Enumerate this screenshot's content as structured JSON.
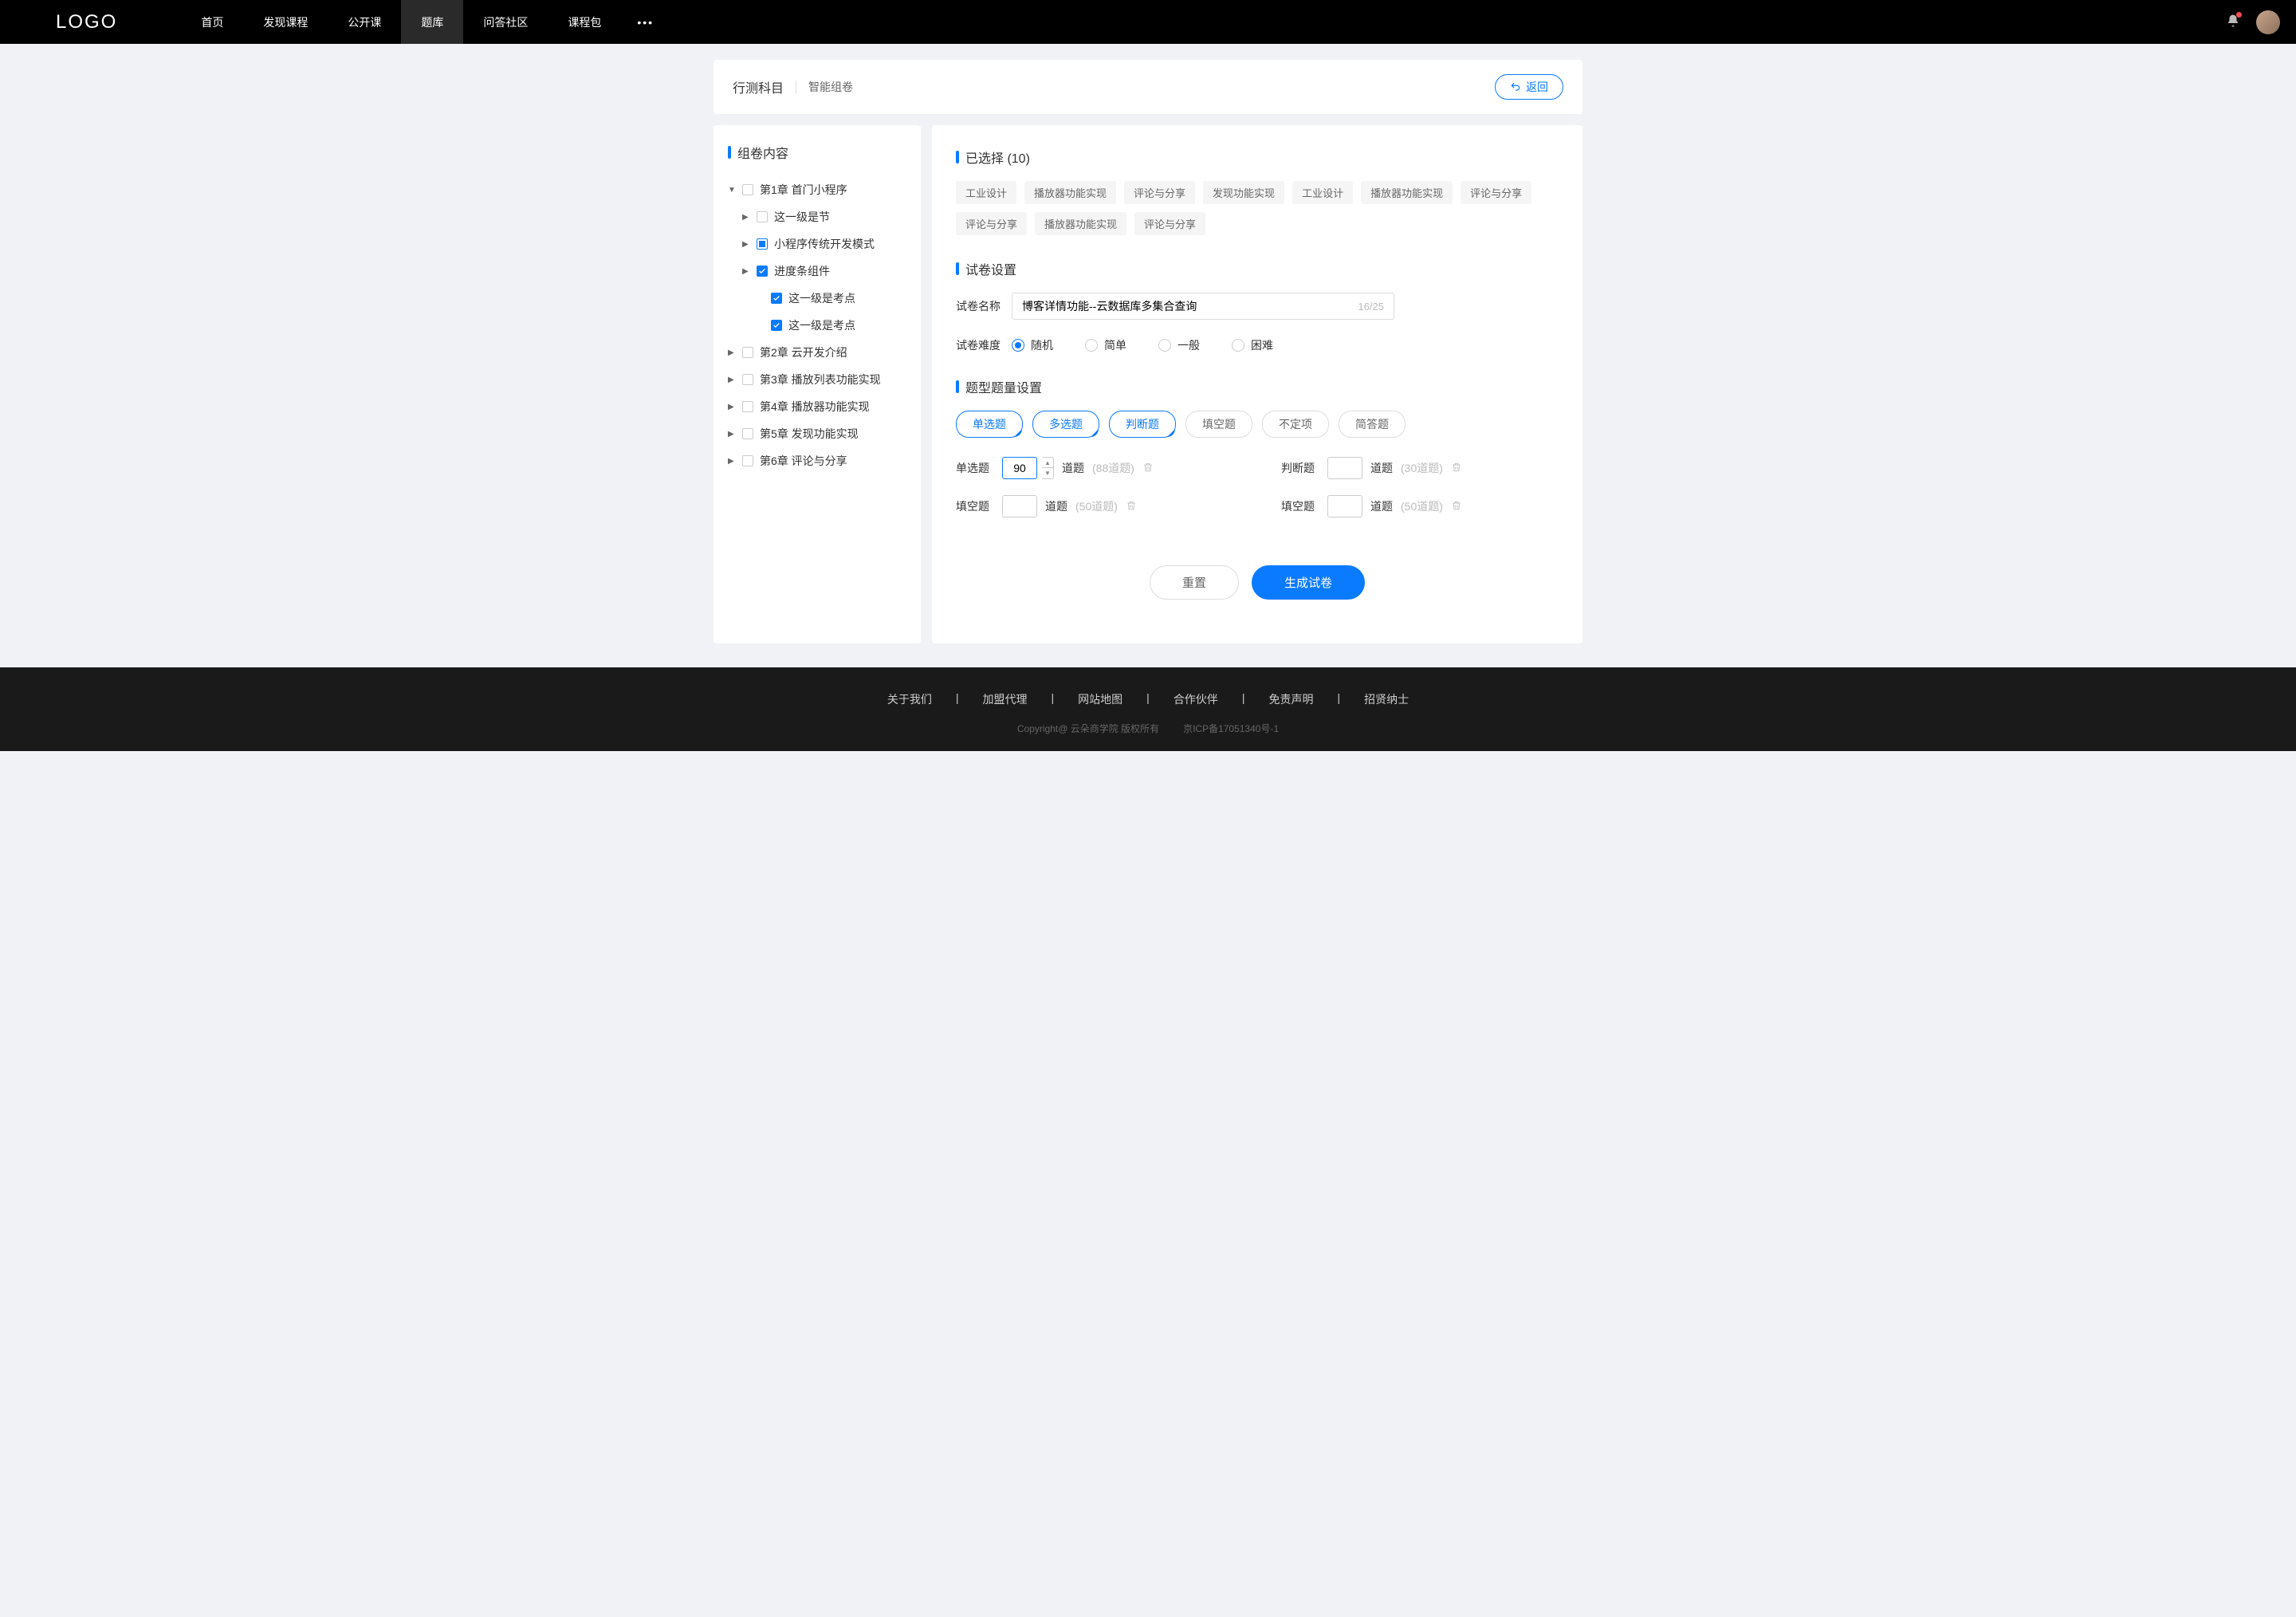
{
  "header": {
    "logo": "LOGO",
    "nav": [
      "首页",
      "发现课程",
      "公开课",
      "题库",
      "问答社区",
      "课程包"
    ],
    "active_nav_index": 3
  },
  "breadcrumb": {
    "title": "行测科目",
    "sub": "智能组卷",
    "back": "返回"
  },
  "sidebar": {
    "title": "组卷内容",
    "tree": [
      {
        "label": "第1章 首门小程序",
        "expanded": true,
        "checked": false,
        "children": [
          {
            "label": "这一级是节",
            "expanded": false,
            "checked": false
          },
          {
            "label": "小程序传统开发模式",
            "expanded": false,
            "checked": "partial"
          },
          {
            "label": "进度条组件",
            "checked": true,
            "children": [
              {
                "label": "这一级是考点",
                "checked": true
              },
              {
                "label": "这一级是考点",
                "checked": true
              }
            ]
          }
        ]
      },
      {
        "label": "第2章 云开发介绍",
        "expanded": false,
        "checked": false
      },
      {
        "label": "第3章 播放列表功能实现",
        "expanded": false,
        "checked": false
      },
      {
        "label": "第4章 播放器功能实现",
        "expanded": false,
        "checked": false
      },
      {
        "label": "第5章 发现功能实现",
        "expanded": false,
        "checked": false
      },
      {
        "label": "第6章 评论与分享",
        "expanded": false,
        "checked": false
      }
    ]
  },
  "selected": {
    "title": "已选择 (10)",
    "tags": [
      "工业设计",
      "播放器功能实现",
      "评论与分享",
      "发现功能实现",
      "工业设计",
      "播放器功能实现",
      "评论与分享",
      "评论与分享",
      "播放器功能实现",
      "评论与分享"
    ]
  },
  "paper": {
    "title": "试卷设置",
    "name_label": "试卷名称",
    "name_value": "博客详情功能--云数据库多集合查询",
    "char_count": "16/25",
    "difficulty_label": "试卷难度",
    "difficulty_options": [
      "随机",
      "简单",
      "一般",
      "困难"
    ],
    "difficulty_selected": 0
  },
  "types": {
    "title": "题型题量设置",
    "options": [
      {
        "label": "单选题",
        "selected": true
      },
      {
        "label": "多选题",
        "selected": true
      },
      {
        "label": "判断题",
        "selected": true
      },
      {
        "label": "填空题",
        "selected": false
      },
      {
        "label": "不定项",
        "selected": false
      },
      {
        "label": "简答题",
        "selected": false
      }
    ],
    "quantities": [
      {
        "label": "单选题",
        "value": "90",
        "unit": "道题",
        "max": "(88道题)",
        "active": true
      },
      {
        "label": "判断题",
        "value": "",
        "unit": "道题",
        "max": "(30道题)",
        "active": false
      },
      {
        "label": "填空题",
        "value": "",
        "unit": "道题",
        "max": "(50道题)",
        "active": false
      },
      {
        "label": "填空题",
        "value": "",
        "unit": "道题",
        "max": "(50道题)",
        "active": false
      }
    ]
  },
  "actions": {
    "reset": "重置",
    "generate": "生成试卷"
  },
  "footer": {
    "links": [
      "关于我们",
      "加盟代理",
      "网站地图",
      "合作伙伴",
      "免责声明",
      "招贤纳士"
    ],
    "copy1": "Copyright@ 云朵商学院   版权所有",
    "copy2": "京ICP备17051340号-1"
  }
}
